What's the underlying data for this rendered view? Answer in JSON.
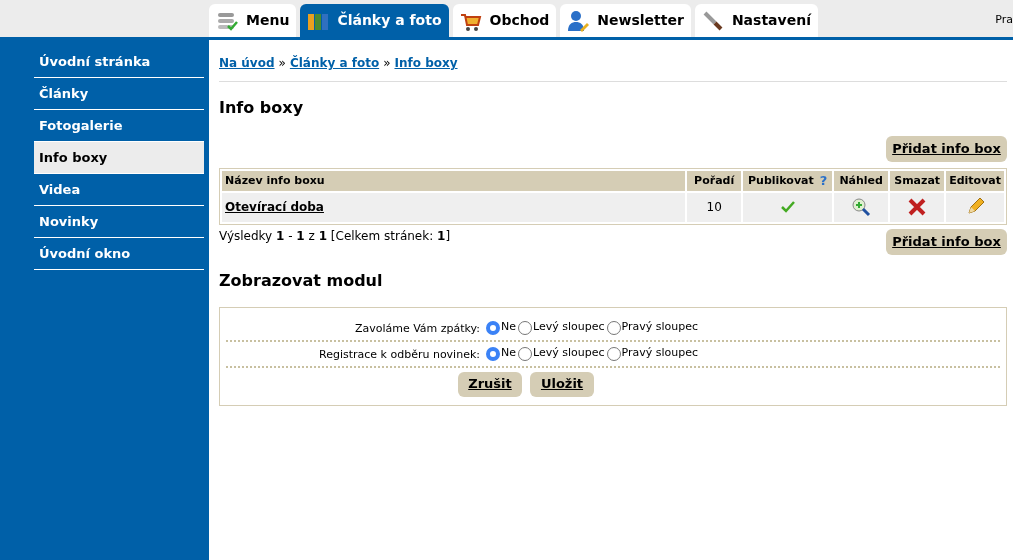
{
  "top_tabs": [
    {
      "label": "Menu",
      "kind": "menu",
      "selected": false
    },
    {
      "label": "Články a foto",
      "kind": "folders",
      "selected": true
    },
    {
      "label": "Obchod",
      "kind": "cart",
      "selected": false
    },
    {
      "label": "Newsletter",
      "kind": "person",
      "selected": false
    },
    {
      "label": "Nastavení",
      "kind": "wrench",
      "selected": false
    }
  ],
  "top_right_text": "Pra",
  "sidebar": {
    "items": [
      {
        "label": "Úvodní stránka",
        "selected": false
      },
      {
        "label": "Články",
        "selected": false
      },
      {
        "label": "Fotogalerie",
        "selected": false
      },
      {
        "label": "Info boxy",
        "selected": true
      },
      {
        "label": "Videa",
        "selected": false
      },
      {
        "label": "Novinky",
        "selected": false
      },
      {
        "label": "Úvodní okno",
        "selected": false
      }
    ]
  },
  "breadcrumb": [
    "Na úvod",
    "Články a foto",
    "Info boxy"
  ],
  "breadcrumb_separator": "»",
  "title": "Info boxy",
  "add_button": "Přidat info box",
  "table": {
    "columns": [
      "Název info boxu",
      "Pořadí",
      "Publikovat",
      "Náhled",
      "Smazat",
      "Editovat"
    ],
    "help_mark": "?",
    "rows": [
      {
        "name": "Otevírací doba",
        "order": "10",
        "published": true
      }
    ]
  },
  "results": "Výsledky **1** - **1** z **1** [Celkem stránek: **1**]",
  "add_button_bottom": "Přidat info box",
  "module": {
    "title": "Zobrazovat modul",
    "rows": [
      {
        "label": "Zavoláme Vám zpátky:",
        "options": [
          {
            "label": "Ne",
            "selected": true
          },
          {
            "label": "Levý sloupec",
            "selected": false
          },
          {
            "label": "Pravý sloupec",
            "selected": false
          }
        ]
      },
      {
        "label": "Registrace k odběru novinek:",
        "options": [
          {
            "label": "Ne",
            "selected": true
          },
          {
            "label": "Levý sloupec",
            "selected": false
          },
          {
            "label": "Pravý sloupec",
            "selected": false
          }
        ]
      }
    ],
    "buttons": [
      "Zrušit",
      "Uložit"
    ]
  }
}
